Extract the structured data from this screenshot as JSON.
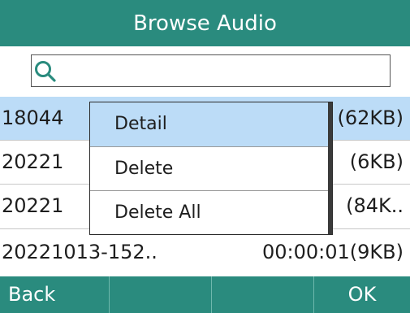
{
  "header": {
    "title": "Browse Audio"
  },
  "search": {
    "icon": "search-icon",
    "value": ""
  },
  "list": {
    "rows": [
      {
        "name": "18044",
        "meta": "(62KB)",
        "selected": true
      },
      {
        "name": "20221",
        "meta": "(6KB)",
        "selected": false
      },
      {
        "name": "20221",
        "meta": "(84K..",
        "selected": false
      },
      {
        "name": "20221013-152..",
        "meta": "00:00:01(9KB)",
        "selected": false
      }
    ]
  },
  "popup": {
    "items": [
      {
        "label": "Detail",
        "active": true
      },
      {
        "label": "Delete",
        "active": false
      },
      {
        "label": "Delete All",
        "active": false
      }
    ]
  },
  "softkeys": {
    "left": "Back",
    "slot2": "",
    "slot3": "",
    "right": "OK"
  },
  "colors": {
    "accent": "#2a8b7e",
    "selection": "#bcdcf7"
  }
}
